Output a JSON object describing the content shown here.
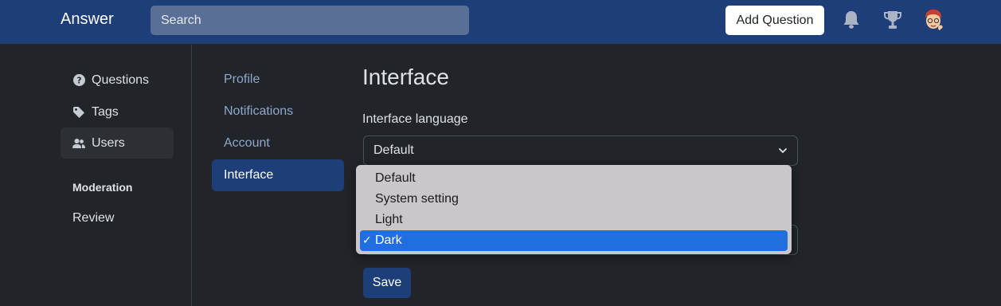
{
  "header": {
    "brand": "Answer",
    "search_placeholder": "Search",
    "add_question_label": "Add Question",
    "bell_icon": "bell-icon",
    "trophy_icon": "trophy-icon"
  },
  "sidebar": {
    "items": [
      {
        "label": "Questions",
        "icon": "question-circle-icon"
      },
      {
        "label": "Tags",
        "icon": "tag-icon"
      },
      {
        "label": "Users",
        "icon": "people-icon",
        "active": true
      }
    ],
    "section_label": "Moderation",
    "review_label": "Review"
  },
  "settings_nav": {
    "items": [
      {
        "label": "Profile"
      },
      {
        "label": "Notifications"
      },
      {
        "label": "Account"
      },
      {
        "label": "Interface",
        "active": true
      }
    ]
  },
  "main": {
    "title": "Interface",
    "language_label": "Interface language",
    "language_value": "Default",
    "color_scheme_options": [
      "Default",
      "System setting",
      "Light",
      "Dark"
    ],
    "color_scheme_selected": "Dark",
    "check_mark": "✓",
    "save_label": "Save"
  },
  "colors": {
    "header_bg": "#1d3e78",
    "page_bg": "#212529",
    "accent": "#1f6fde",
    "link": "#8fa7cd"
  }
}
